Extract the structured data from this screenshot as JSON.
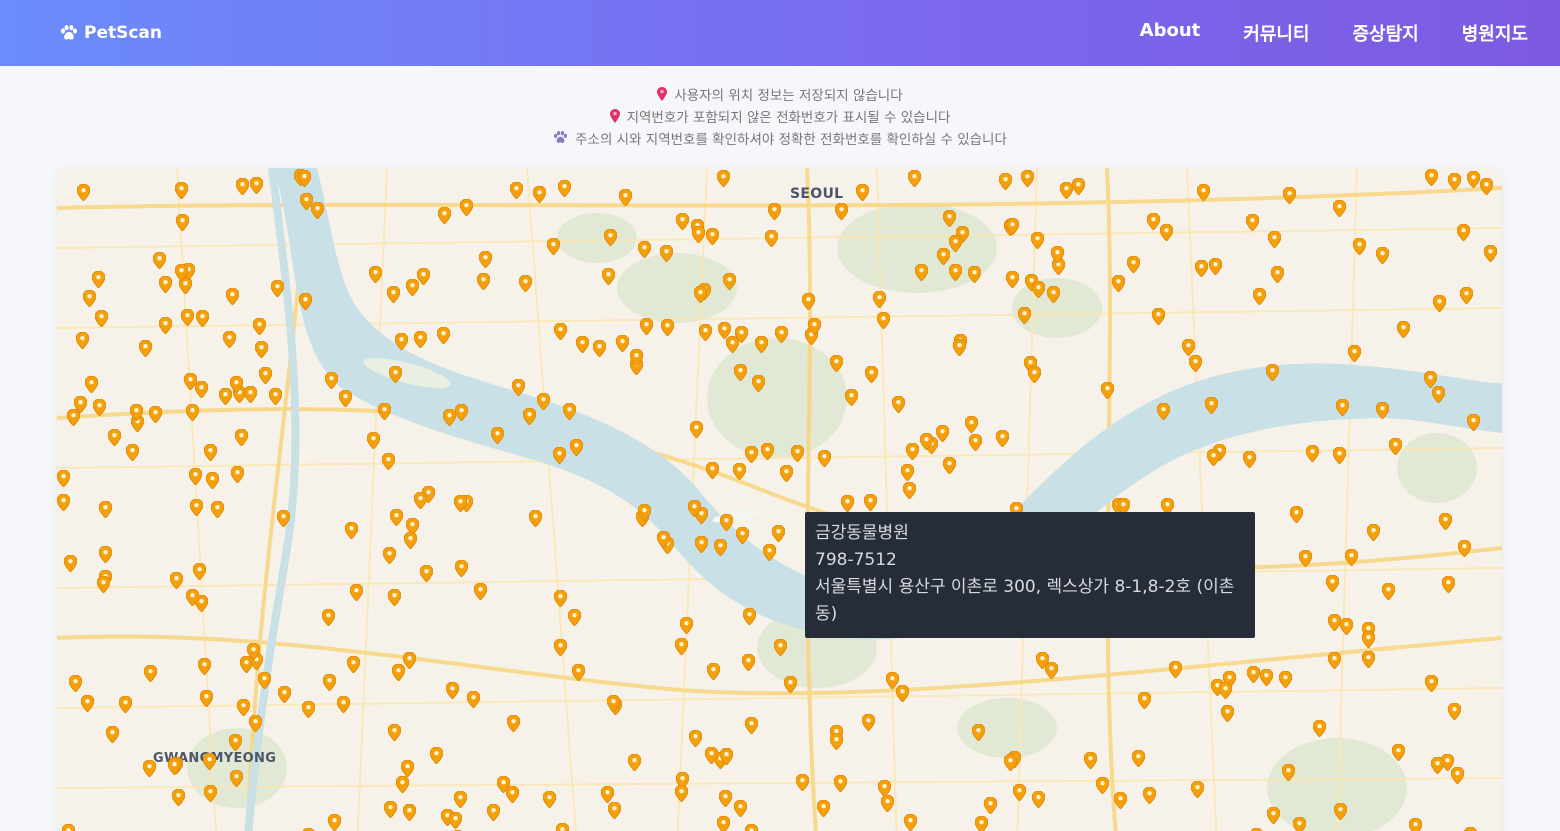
{
  "app": {
    "name": "PetScan",
    "logo_icon": "paw-icon"
  },
  "nav": {
    "items": [
      {
        "label": "About"
      },
      {
        "label": "커뮤니티"
      },
      {
        "label": "증상탐지"
      },
      {
        "label": "병원지도"
      }
    ]
  },
  "notices": [
    {
      "icon": "pin-icon",
      "text": "사용자의 위치 정보는 저장되지 않습니다"
    },
    {
      "icon": "pin-icon",
      "text": "지역번호가 포함되지 않은 전화번호가 표시될 수 있습니다"
    },
    {
      "icon": "paw-icon",
      "text": "주소의 시와 지역번호를 확인하셔야 정확한 전화번호를 확인하실 수 있습니다"
    }
  ],
  "map": {
    "labels": {
      "seoul": "SEOUL",
      "gwangmyeong": "GWANGMYEONG"
    },
    "marker_color": "#f5a00a"
  },
  "tooltip": {
    "name": "금강동물병원",
    "phone": "798-7512",
    "address": "서울특별시 용산구 이촌로 300, 렉스상가 8-1,8-2호 (이촌동)"
  },
  "colors": {
    "header_start": "#6b8cfb",
    "header_end": "#7c5ae0",
    "river": "#c8e0e6",
    "marker": "#f5a00a"
  }
}
